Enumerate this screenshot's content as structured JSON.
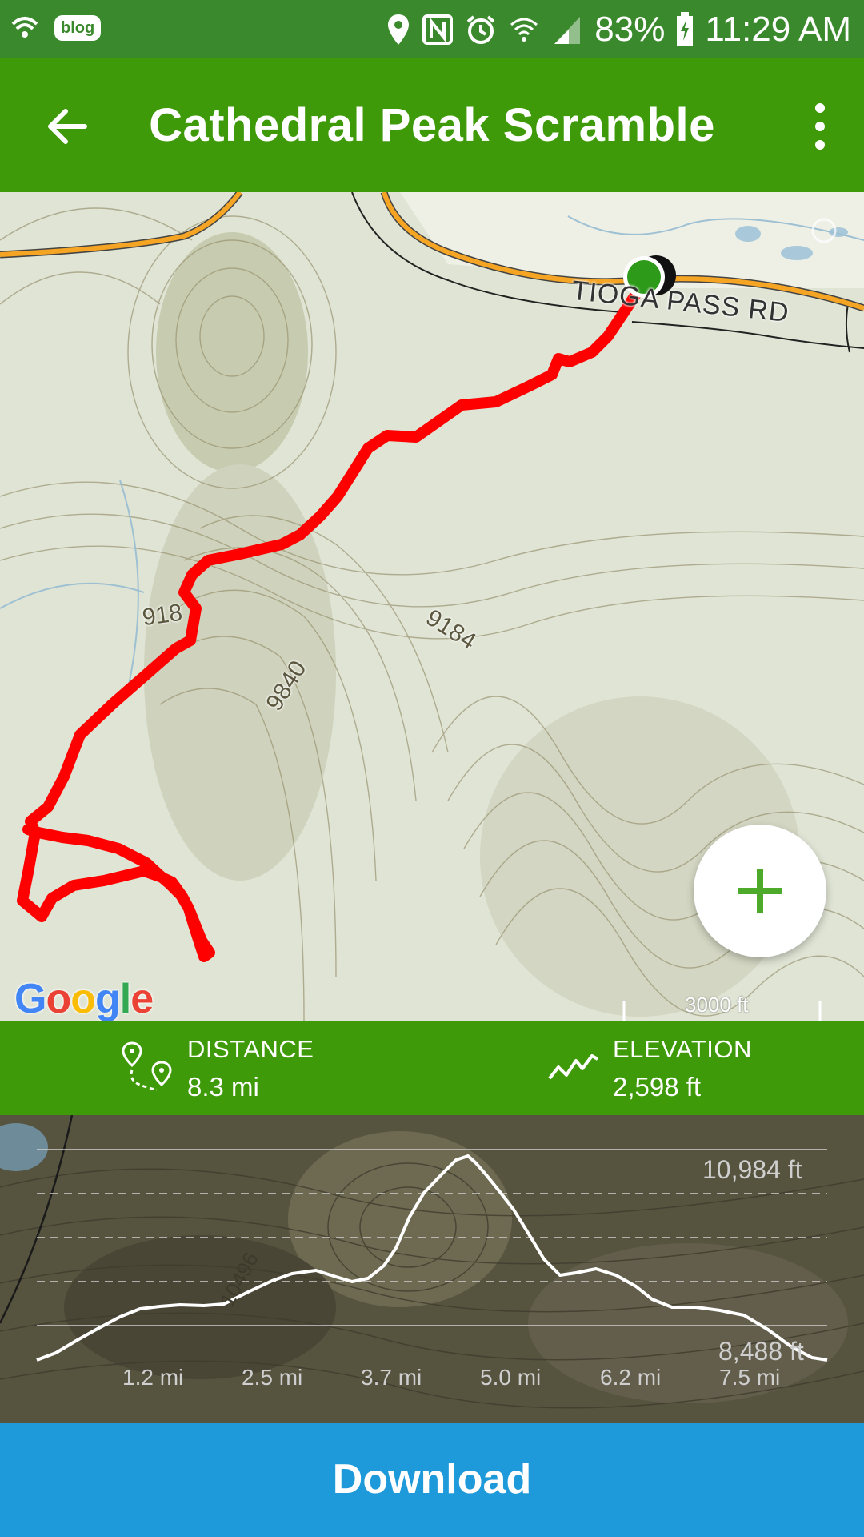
{
  "status_bar": {
    "blog_badge": "blog",
    "battery": "83%",
    "time": "11:29 AM",
    "icons": [
      "wifi-call-icon",
      "blog-icon",
      "location-icon",
      "nfc-icon",
      "alarm-icon",
      "wifi-icon",
      "signal-icon",
      "battery-icon"
    ]
  },
  "app_bar": {
    "title": "Cathedral Peak Scramble",
    "back_icon": "arrow-left-icon",
    "menu_icon": "more-vert-icon"
  },
  "map": {
    "road_label": "TIOGA PASS RD",
    "contour_labels": [
      "918",
      "9184",
      "9840"
    ],
    "scale_label": "3000 ft",
    "attribution": "Google",
    "route_color": "#ff0000",
    "start_marker_color": "#2e9a1a",
    "zoom_button_icon": "plus-icon"
  },
  "stats": {
    "distance_label": "DISTANCE",
    "distance_value": "8.3 mi",
    "elevation_label": "ELEVATION",
    "elevation_value": "2,598 ft"
  },
  "elevation_profile": {
    "contour_label": "10496",
    "max_label": "10,984 ft",
    "min_label": "8,488 ft",
    "x_ticks": [
      "1.2 mi",
      "2.5 mi",
      "3.7 mi",
      "5.0 mi",
      "6.2 mi",
      "7.5 mi"
    ]
  },
  "download_label": "Download",
  "colors": {
    "status_bar": "#3a8a2d",
    "app_bar": "#3e9a08",
    "download": "#1e9adb"
  }
}
